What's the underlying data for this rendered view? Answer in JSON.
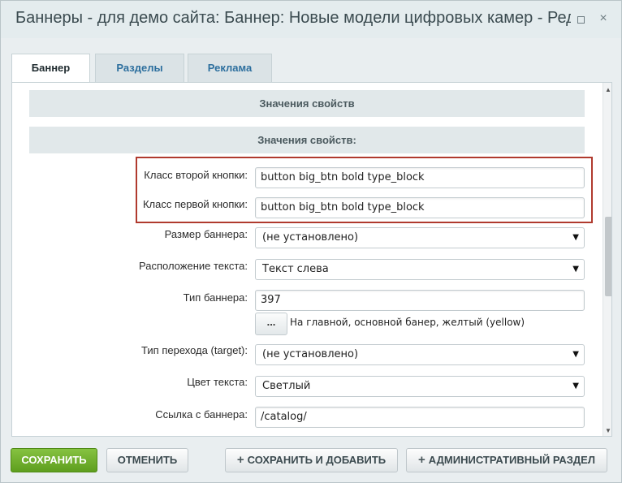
{
  "window": {
    "title": "Баннеры - для демо сайта: Баннер: Новые модели цифровых камер - Редактирование",
    "maximize_icon": "maximize-icon",
    "close_icon": "close-icon",
    "close_glyph": "×"
  },
  "tabs": [
    {
      "label": "Баннер",
      "active": true
    },
    {
      "label": "Разделы",
      "active": false
    },
    {
      "label": "Реклама",
      "active": false
    }
  ],
  "sections": {
    "header1": "Значения свойств",
    "header2": "Значения свойств:"
  },
  "fields": {
    "second_button_class": {
      "label": "Класс второй кнопки:",
      "value": "button big_btn bold type_block"
    },
    "first_button_class": {
      "label": "Класс первой кнопки:",
      "value": "button big_btn bold type_block"
    },
    "banner_size": {
      "label": "Размер баннера:",
      "value": "(не установлено)"
    },
    "text_position": {
      "label": "Расположение текста:",
      "value": "Текст слева"
    },
    "banner_type": {
      "label": "Тип баннера:",
      "value": "397",
      "button": "...",
      "note": "На главной, основной банер, желтый (yellow)"
    },
    "link_target": {
      "label": "Тип перехода (target):",
      "value": "(не установлено)"
    },
    "text_color": {
      "label": "Цвет текста:",
      "value": "Светлый"
    },
    "banner_link": {
      "label": "Ссылка с баннера:",
      "value": "/catalog/"
    }
  },
  "buttons": {
    "save": "СОХРАНИТЬ",
    "cancel": "ОТМЕНИТЬ",
    "save_add": "СОХРАНИТЬ И ДОБАВИТЬ",
    "admin": "АДМИНИСТРАТИВНЫЙ РАЗДЕЛ",
    "plus": "+"
  },
  "colors": {
    "save_green": "#6aaa28",
    "highlight_red": "#b03a2e",
    "tab_link_blue": "#2d6f9e"
  }
}
